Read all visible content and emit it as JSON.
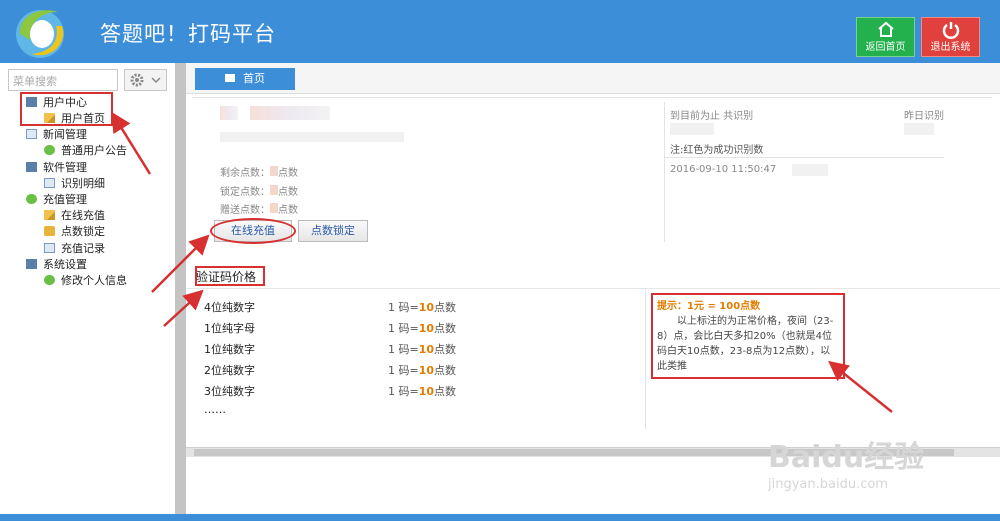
{
  "header": {
    "title": "答题吧！打码平台",
    "home_button": "返回首页",
    "logout_button": "退出系统",
    "colors": {
      "bar": "#3d8ed8",
      "home": "#22b14c",
      "logout": "#e0413c"
    }
  },
  "sidebar": {
    "search_placeholder": "菜单搜索",
    "items": [
      {
        "label": "用户中心",
        "icon": "monitor-icon"
      },
      {
        "label": "用户首页",
        "icon": "pencil-icon"
      },
      {
        "label": "新闻管理",
        "icon": "document-icon"
      },
      {
        "label": "普通用户公告",
        "icon": "check-icon"
      },
      {
        "label": "软件管理",
        "icon": "monitor-icon"
      },
      {
        "label": "识别明细",
        "icon": "document-icon"
      },
      {
        "label": "充值管理",
        "icon": "check-icon"
      },
      {
        "label": "在线充值",
        "icon": "pencil-icon"
      },
      {
        "label": "点数锁定",
        "icon": "lock-icon"
      },
      {
        "label": "充值记录",
        "icon": "document-icon"
      },
      {
        "label": "系统设置",
        "icon": "monitor-icon"
      },
      {
        "label": "修改个人信息",
        "icon": "check-icon"
      }
    ]
  },
  "main": {
    "tab_home": "首页",
    "account": {
      "remain": "剩余点数：",
      "locked": "锁定点数：",
      "gift": "赠送点数：",
      "unit": "点数"
    },
    "buttons": {
      "recharge": "在线充值",
      "lock": "点数锁定"
    },
    "stats": {
      "total_label": "到目前为止 共识别",
      "yesterday_label": "昨日识别",
      "note": "注:红色为成功识别数",
      "timestamp": "2016-09-10 11:50:47"
    },
    "price_section": {
      "title": "验证码价格",
      "rows": [
        {
          "type": "4位纯数字",
          "unit": "1 码=",
          "points": "10",
          "suffix": "点数"
        },
        {
          "type": "1位纯字母",
          "unit": "1 码=",
          "points": "10",
          "suffix": "点数"
        },
        {
          "type": "1位纯数字",
          "unit": "1 码=",
          "points": "10",
          "suffix": "点数"
        },
        {
          "type": "2位纯数字",
          "unit": "1 码=",
          "points": "10",
          "suffix": "点数"
        },
        {
          "type": "3位纯数字",
          "unit": "1 码=",
          "points": "10",
          "suffix": "点数"
        }
      ],
      "more": "……",
      "tip_head": "提示：1元 = 100点数",
      "tip_body": "以上标注的为正常价格，夜间（23-8）点，会比白天多扣20%（也就是4位码白天10点数，23-8点为12点数），以此类推"
    }
  },
  "watermark": {
    "main": "Baidu经验",
    "sub": "jingyan.baidu.com"
  }
}
